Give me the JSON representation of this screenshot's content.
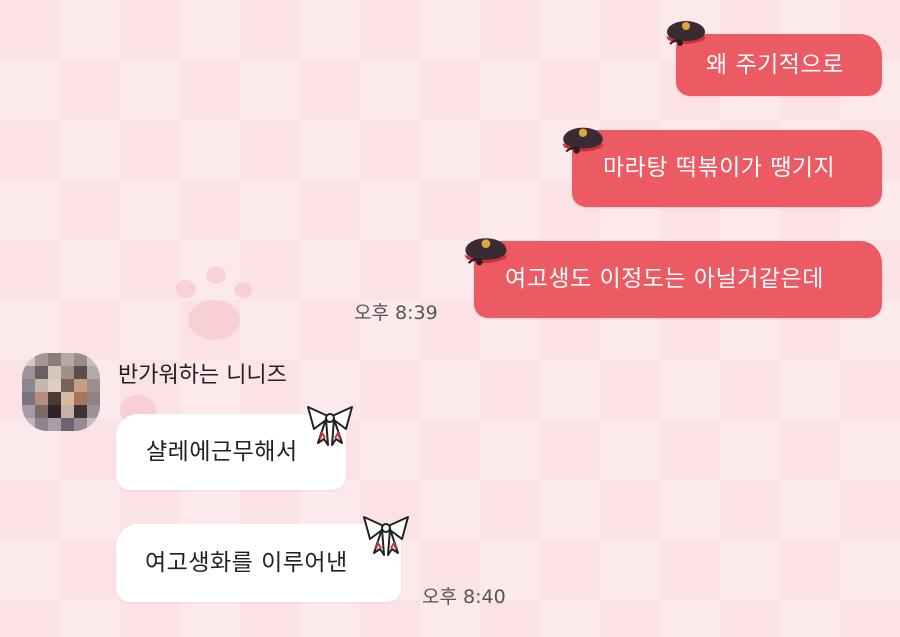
{
  "outgoing": [
    {
      "text": "왜 주기적으로"
    },
    {
      "text": "마라탕 떡볶이가 땡기지"
    },
    {
      "text": "여고생도 이정도는 아닐거같은데"
    }
  ],
  "outgoing_time": "오후 8:39",
  "incoming_sender": "반가워하는 니니즈",
  "incoming": [
    {
      "text": "샬레에근무해서"
    },
    {
      "text": "여고생화를 이루어낸"
    }
  ],
  "incoming_time": "오후 8:40",
  "colors": {
    "background": "#fbe3e5",
    "outgoing_bubble": "#ec5b63",
    "incoming_bubble": "#ffffff"
  },
  "icons": {
    "outgoing_sticker": "police-cap-character-icon",
    "incoming_sticker": "ribbon-bow-icon",
    "avatar": "pixelated-profile-avatar"
  }
}
